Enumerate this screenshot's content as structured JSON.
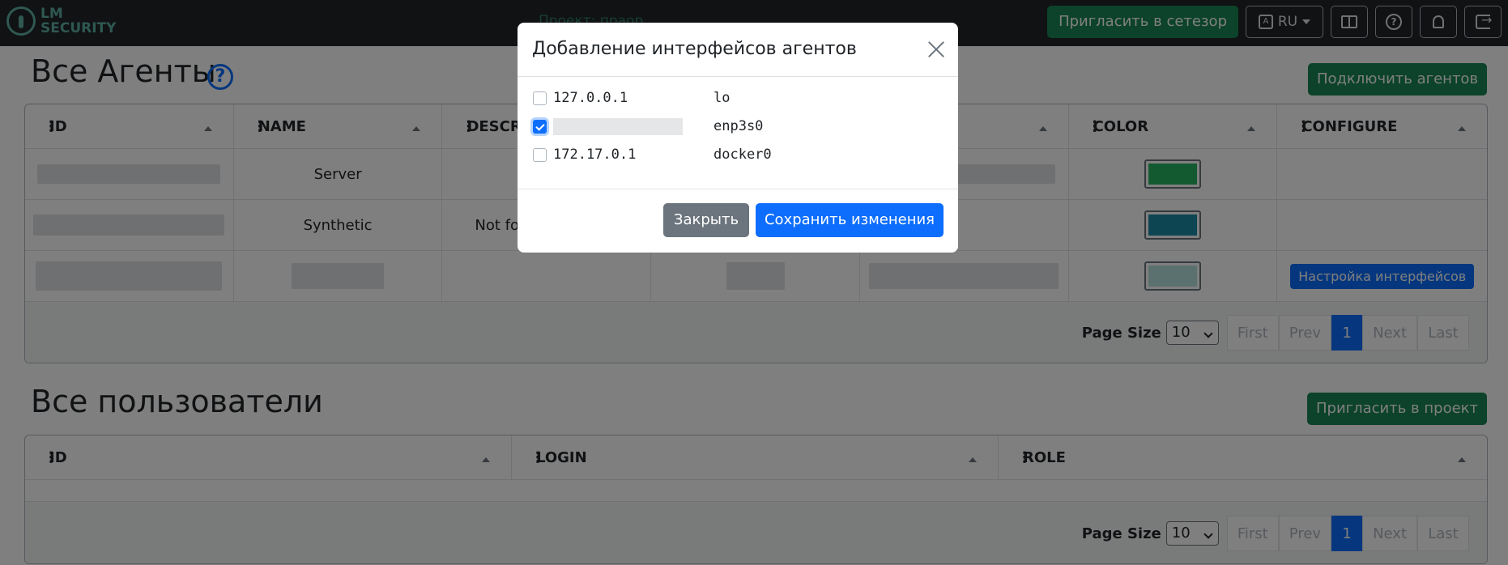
{
  "navbar": {
    "logo_line1": "LM",
    "logo_line2": "SECURITY",
    "project_title": "Проект: праор",
    "invite_network_label": "Пригласить в сетезор",
    "lang_label": "RU",
    "icons": [
      "translate-icon",
      "book-icon",
      "help-icon",
      "bell-icon",
      "logout-icon"
    ]
  },
  "agents": {
    "title": "Все Агенты",
    "help_symbol": "?",
    "connect_label": "Подключить агентов",
    "columns": [
      "ID",
      "NAME",
      "DESCRIPTION",
      "",
      "",
      "COLOR",
      "CONFIGURE"
    ],
    "rows": [
      {
        "name": "Server",
        "description": "",
        "color": "#28b463"
      },
      {
        "name": "Synthetic",
        "description": "Not fo",
        "color": "#1a8aa6"
      },
      {
        "name": "",
        "description": "",
        "color": "#b7e3e0",
        "configure_label": "Настройка интерфейсов"
      }
    ],
    "pagination": {
      "page_size_label": "Page Size",
      "page_size_value": "10",
      "first": "First",
      "prev": "Prev",
      "current": "1",
      "next": "Next",
      "last": "Last"
    }
  },
  "users": {
    "title": "Все пользователи",
    "invite_project_label": "Пригласить в проект",
    "columns": [
      "ID",
      "LOGIN",
      "ROLE"
    ],
    "pagination": {
      "page_size_label": "Page Size",
      "page_size_value": "10",
      "first": "First",
      "prev": "Prev",
      "current": "1",
      "next": "Next",
      "last": "Last"
    }
  },
  "modal": {
    "title": "Добавление интерфейсов агентов",
    "interfaces": [
      {
        "ip": "127.0.0.1",
        "name": "lo",
        "checked": false
      },
      {
        "ip": "",
        "name": "enp3s0",
        "checked": true
      },
      {
        "ip": "172.17.0.1",
        "name": "docker0",
        "checked": false
      }
    ],
    "close_label": "Закрыть",
    "save_label": "Сохранить изменения"
  }
}
